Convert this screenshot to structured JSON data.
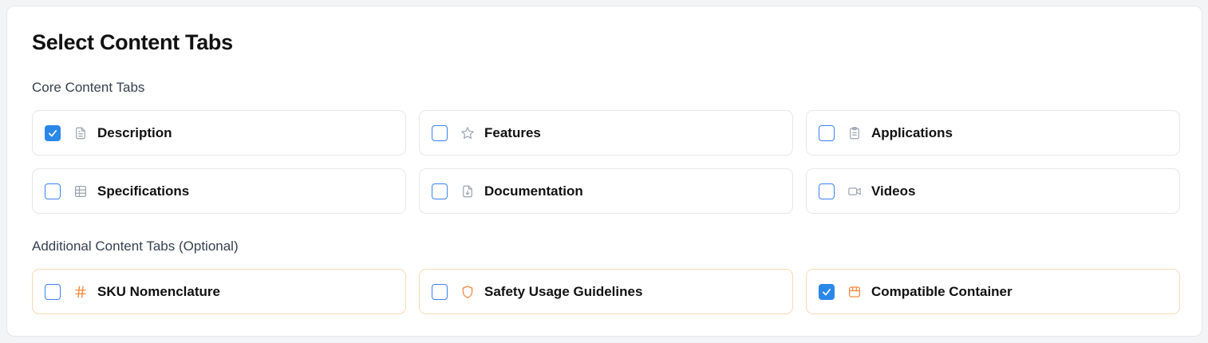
{
  "panel": {
    "title": "Select Content Tabs"
  },
  "core_section": {
    "label": "Core Content Tabs",
    "items": [
      {
        "label": "Description",
        "checked": true,
        "icon": "document-icon"
      },
      {
        "label": "Features",
        "checked": false,
        "icon": "star-icon"
      },
      {
        "label": "Applications",
        "checked": false,
        "icon": "clipboard-list-icon"
      },
      {
        "label": "Specifications",
        "checked": false,
        "icon": "table-icon"
      },
      {
        "label": "Documentation",
        "checked": false,
        "icon": "file-download-icon"
      },
      {
        "label": "Videos",
        "checked": false,
        "icon": "video-icon"
      }
    ]
  },
  "additional_section": {
    "label": "Additional Content Tabs (Optional)",
    "items": [
      {
        "label": "SKU Nomenclature",
        "checked": false,
        "icon": "hash-icon"
      },
      {
        "label": "Safety Usage Guidelines",
        "checked": false,
        "icon": "shield-icon"
      },
      {
        "label": "Compatible Container",
        "checked": true,
        "icon": "container-icon"
      }
    ]
  },
  "colors": {
    "checkbox_accent": "#2b87e8",
    "core_icon": "#9ca3af",
    "optional_icon": "#f5893b",
    "optional_border": "#fcd9b4"
  }
}
